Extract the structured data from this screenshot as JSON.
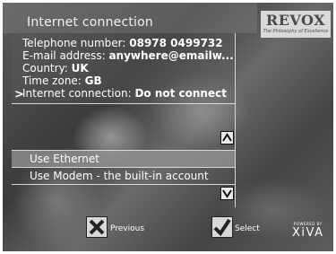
{
  "header": {
    "title": "Internet connection"
  },
  "logo": {
    "name": "REVOX",
    "tagline": "The Philosophy of Excellence"
  },
  "info": [
    {
      "label": "Telephone number: ",
      "value": "08978 0499732"
    },
    {
      "label": "E-mail address: ",
      "value": "anywhere@emailw..."
    },
    {
      "label": "Country: ",
      "value": "UK"
    },
    {
      "label": "Time zone: ",
      "value": "GB"
    },
    {
      "label": "Internet connection: ",
      "value": "Do not connect"
    }
  ],
  "cursor": ">",
  "options": [
    {
      "label": "Use Ethernet",
      "selected": true
    },
    {
      "label": "Use Modem - the built-in account",
      "selected": false
    }
  ],
  "actions": {
    "previous": "Previous",
    "select": "Select"
  },
  "branding": {
    "powered_by": "POWERED BY",
    "name": "XiVA"
  },
  "icons": {
    "scroll_up": "chevron-up-icon",
    "scroll_down": "chevron-down-icon",
    "previous": "x-icon",
    "select": "checkmark-icon"
  },
  "colors": {
    "selected_row": "#969696",
    "logo_bg": "#d9d9d9"
  }
}
